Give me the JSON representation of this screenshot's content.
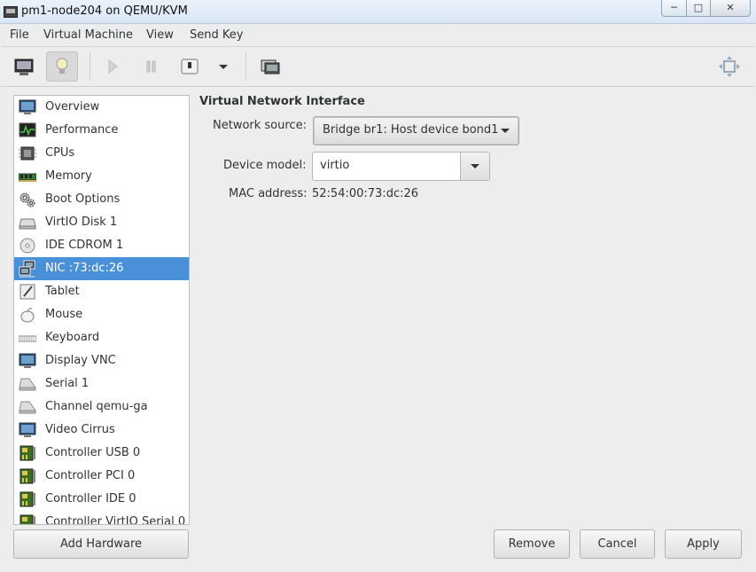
{
  "window": {
    "title": "pm1-node204 on QEMU/KVM"
  },
  "menu": [
    "File",
    "Virtual Machine",
    "View",
    "Send Key"
  ],
  "toolbar": {
    "buttons": [
      "console-icon",
      "details-lightbulb-icon",
      "run-icon",
      "pause-icon",
      "shutdown-icon",
      "shutdown-menu-icon",
      "snapshots-icon",
      "fullscreen-icon"
    ]
  },
  "sidebar": {
    "items": [
      {
        "label": "Overview",
        "icon": "monitor-icon"
      },
      {
        "label": "Performance",
        "icon": "performance-graph-icon"
      },
      {
        "label": "CPUs",
        "icon": "cpu-icon"
      },
      {
        "label": "Memory",
        "icon": "memory-icon"
      },
      {
        "label": "Boot Options",
        "icon": "gears-icon"
      },
      {
        "label": "VirtIO Disk 1",
        "icon": "disk-icon"
      },
      {
        "label": "IDE CDROM 1",
        "icon": "cdrom-icon"
      },
      {
        "label": "NIC :73:dc:26",
        "icon": "network-icon",
        "selected": true
      },
      {
        "label": "Tablet",
        "icon": "tablet-icon"
      },
      {
        "label": "Mouse",
        "icon": "mouse-icon"
      },
      {
        "label": "Keyboard",
        "icon": "keyboard-icon"
      },
      {
        "label": "Display VNC",
        "icon": "display-icon"
      },
      {
        "label": "Serial 1",
        "icon": "serial-icon"
      },
      {
        "label": "Channel qemu-ga",
        "icon": "channel-icon"
      },
      {
        "label": "Video Cirrus",
        "icon": "video-icon"
      },
      {
        "label": "Controller USB 0",
        "icon": "controller-icon"
      },
      {
        "label": "Controller PCI 0",
        "icon": "controller-icon"
      },
      {
        "label": "Controller IDE 0",
        "icon": "controller-icon"
      },
      {
        "label": "Controller VirtIO Serial 0",
        "icon": "controller-icon"
      }
    ],
    "add_hardware": "Add Hardware"
  },
  "nic": {
    "section_title": "Virtual Network Interface",
    "network_source_label": "Network source:",
    "network_source_value": "Bridge br1: Host device bond1",
    "device_model_label": "Device model:",
    "device_model_value": "virtio",
    "mac_label": "MAC address:",
    "mac_value": "52:54:00:73:dc:26"
  },
  "actions": {
    "remove": "Remove",
    "cancel": "Cancel",
    "apply": "Apply"
  },
  "colors": {
    "selection": "#4a90d9"
  }
}
